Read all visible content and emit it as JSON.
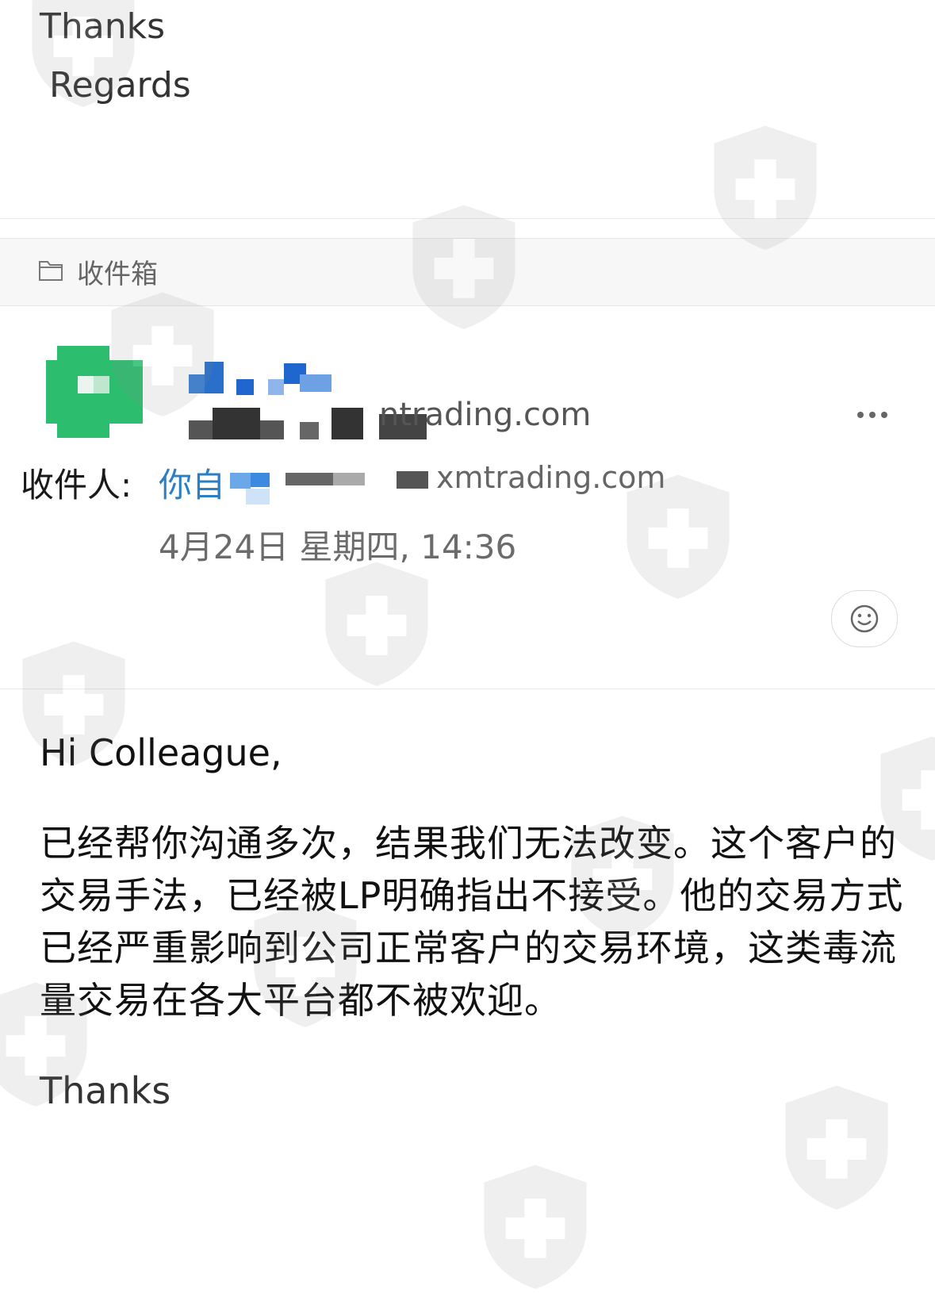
{
  "previous_message": {
    "thanks": "Thanks",
    "regards": "Regards"
  },
  "folder": {
    "icon": "folder-icon",
    "label": "收件箱"
  },
  "sender": {
    "email_visible": "ntrading.com"
  },
  "recipient": {
    "label": "收件人:",
    "name_visible": "你自",
    "email_visible": "xmtrading.com"
  },
  "date": "4月24日 星期四, 14:36",
  "menu_icon": "more-dots-icon",
  "reaction_icon": "smiley-icon",
  "message": {
    "greeting": "Hi Colleague,",
    "body": "已经帮你沟通多次，结果我们无法改变。这个客户的交易手法，已经被LP明确指出不接受。他的交易方式已经严重影响到公司正常客户的交易环境，这类毒流量交易在各大平台都不被欢迎。",
    "closing": "Thanks"
  },
  "colors": {
    "link": "#2b7fc4",
    "avatar": "#2dbd6e",
    "watermark": "#9a9a9a"
  }
}
